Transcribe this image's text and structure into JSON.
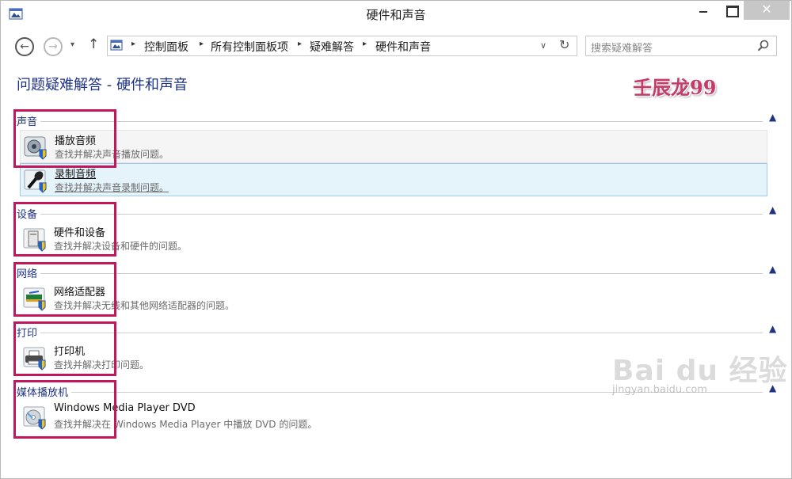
{
  "window": {
    "title": "硬件和声音",
    "close_glyph": "✕"
  },
  "nav": {
    "back_glyph": "←",
    "forward_glyph": "→",
    "dropdown_glyph": "▾",
    "up_glyph": "↑",
    "breadcrumbs": [
      "控制面板",
      "所有控制面板项",
      "疑难解答",
      "硬件和声音"
    ],
    "breadcrumb_sep": "▸",
    "address_dropdown_glyph": "∨",
    "refresh_glyph": "↻",
    "search_placeholder": "搜索疑难解答"
  },
  "page": {
    "title": "问题疑难解答 - 硬件和声音",
    "author_watermark": "壬辰龙99"
  },
  "groups": [
    {
      "label": "声音",
      "caret": "▲",
      "tasks": [
        {
          "title": "播放音频",
          "desc": "查找并解决声音播放问题。",
          "icon": "speaker-icon",
          "state": "hover"
        },
        {
          "title": "录制音频",
          "desc": "查找并解决声音录制问题。",
          "icon": "microphone-icon",
          "state": "selected"
        }
      ]
    },
    {
      "label": "设备",
      "caret": "▲",
      "tasks": [
        {
          "title": "硬件和设备",
          "desc": "查找并解决设备和硬件的问题。",
          "icon": "hardware-icon",
          "state": "normal"
        }
      ]
    },
    {
      "label": "网络",
      "caret": "▲",
      "tasks": [
        {
          "title": "网络适配器",
          "desc": "查找并解决无线和其他网络适配器的问题。",
          "icon": "network-adapter-icon",
          "state": "normal"
        }
      ]
    },
    {
      "label": "打印",
      "caret": "▲",
      "tasks": [
        {
          "title": "打印机",
          "desc": "查找并解决打印问题。",
          "icon": "printer-icon",
          "state": "normal"
        }
      ]
    },
    {
      "label": "媒体播放机",
      "caret": "▲",
      "tasks": [
        {
          "title": "Windows Media Player DVD",
          "desc": "查找并解决在 Windows Media Player 中播放 DVD 的问题。",
          "icon": "dvd-icon",
          "state": "normal"
        }
      ]
    }
  ],
  "watermark": {
    "brand": "Bai du 经验",
    "url": "jingyan.baidu.com"
  },
  "colors": {
    "highlight_box": "#c2185b",
    "group_label": "#1e3287",
    "selected_bg": "#e5f3fb"
  }
}
